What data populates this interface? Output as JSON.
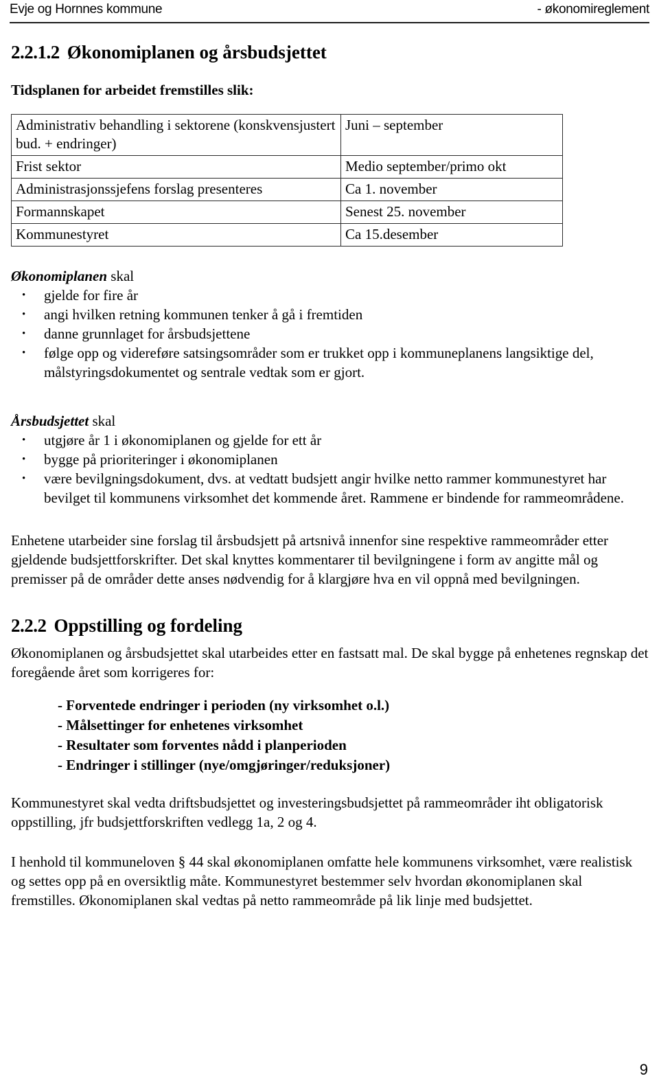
{
  "header": {
    "left": "Evje og Hornnes kommune",
    "right": "- økonomireglement"
  },
  "section_1": {
    "number": "2.2.1.2",
    "title": "Økonomiplanen og årsbudsjettet",
    "intro": "Tidsplanen for arbeidet fremstilles slik:"
  },
  "timetable": {
    "rows": [
      {
        "task": "Administrativ behandling i sektorene (konskvensjustert bud. + endringer)",
        "time": "Juni – september"
      },
      {
        "task": "Frist sektor",
        "time": "Medio september/primo okt"
      },
      {
        "task": "Administrasjonssjefens forslag presenteres",
        "time": "Ca 1. november"
      },
      {
        "task": "Formannskapet",
        "time": "Senest 25. november"
      },
      {
        "task": "Kommunestyret",
        "time": "Ca 15.desember"
      }
    ]
  },
  "okonomiplanen": {
    "title_emph": "Økonomiplanen",
    "title_rest": " skal",
    "items": [
      "gjelde for fire år",
      "angi hvilken retning kommunen tenker å gå i fremtiden",
      "danne grunnlaget for årsbudsjettene",
      "følge opp og videreføre satsingsområder som er trukket opp i kommuneplanens langsiktige del, målstyringsdokumentet  og sentrale vedtak som er gjort."
    ]
  },
  "arsbudsjettet": {
    "title_emph": "Årsbudsjettet",
    "title_rest": " skal",
    "items": [
      "utgjøre år 1 i økonomiplanen og gjelde for ett år",
      "bygge på prioriteringer i økonomiplanen",
      "være bevilgningsdokument, dvs. at vedtatt budsjett angir hvilke netto rammer kommunestyret har bevilget til kommunens virksomhet det kommende året. Rammene er bindende for rammeområdene."
    ]
  },
  "paragraph_enhetene": "Enhetene utarbeider sine forslag til årsbudsjett på artsnivå innenfor sine respektive rammeområder etter gjeldende budsjettforskrifter. Det skal knyttes kommentarer til bevilgningene i form av angitte mål og premisser på de områder dette anses nødvendig for å klargjøre hva en vil oppnå med bevilgningen.",
  "section_2": {
    "number": "2.2.2",
    "title": "Oppstilling og fordeling",
    "intro": "Økonomiplanen og årsbudsjettet skal utarbeides etter en fastsatt mal. De skal bygge på enhetenes regnskap det foregående året som korrigeres for:"
  },
  "korrigeres_list": [
    "- Forventede endringer i perioden (ny virksomhet o.l.)",
    "- Målsettinger for enhetenes virksomhet",
    "- Resultater som forventes nådd i planperioden",
    "- Endringer i stillinger (nye/omgjøringer/reduksjoner)"
  ],
  "paragraph_kommunestyret": "Kommunestyret skal vedta driftsbudsjettet og investeringsbudsjettet på rammeområder iht obligatorisk oppstilling, jfr budsjettforskriften vedlegg 1a, 2 og 4.",
  "paragraph_henhold": "I henhold til kommuneloven § 44 skal økonomiplanen omfatte hele kommunens virksomhet, være realistisk og settes opp på en oversiktlig måte. Kommunestyret bestemmer selv hvordan økonomiplanen skal fremstilles. Økonomiplanen skal vedtas på netto rammeområde på lik linje med budsjettet.",
  "footer": {
    "page_number": "9"
  }
}
